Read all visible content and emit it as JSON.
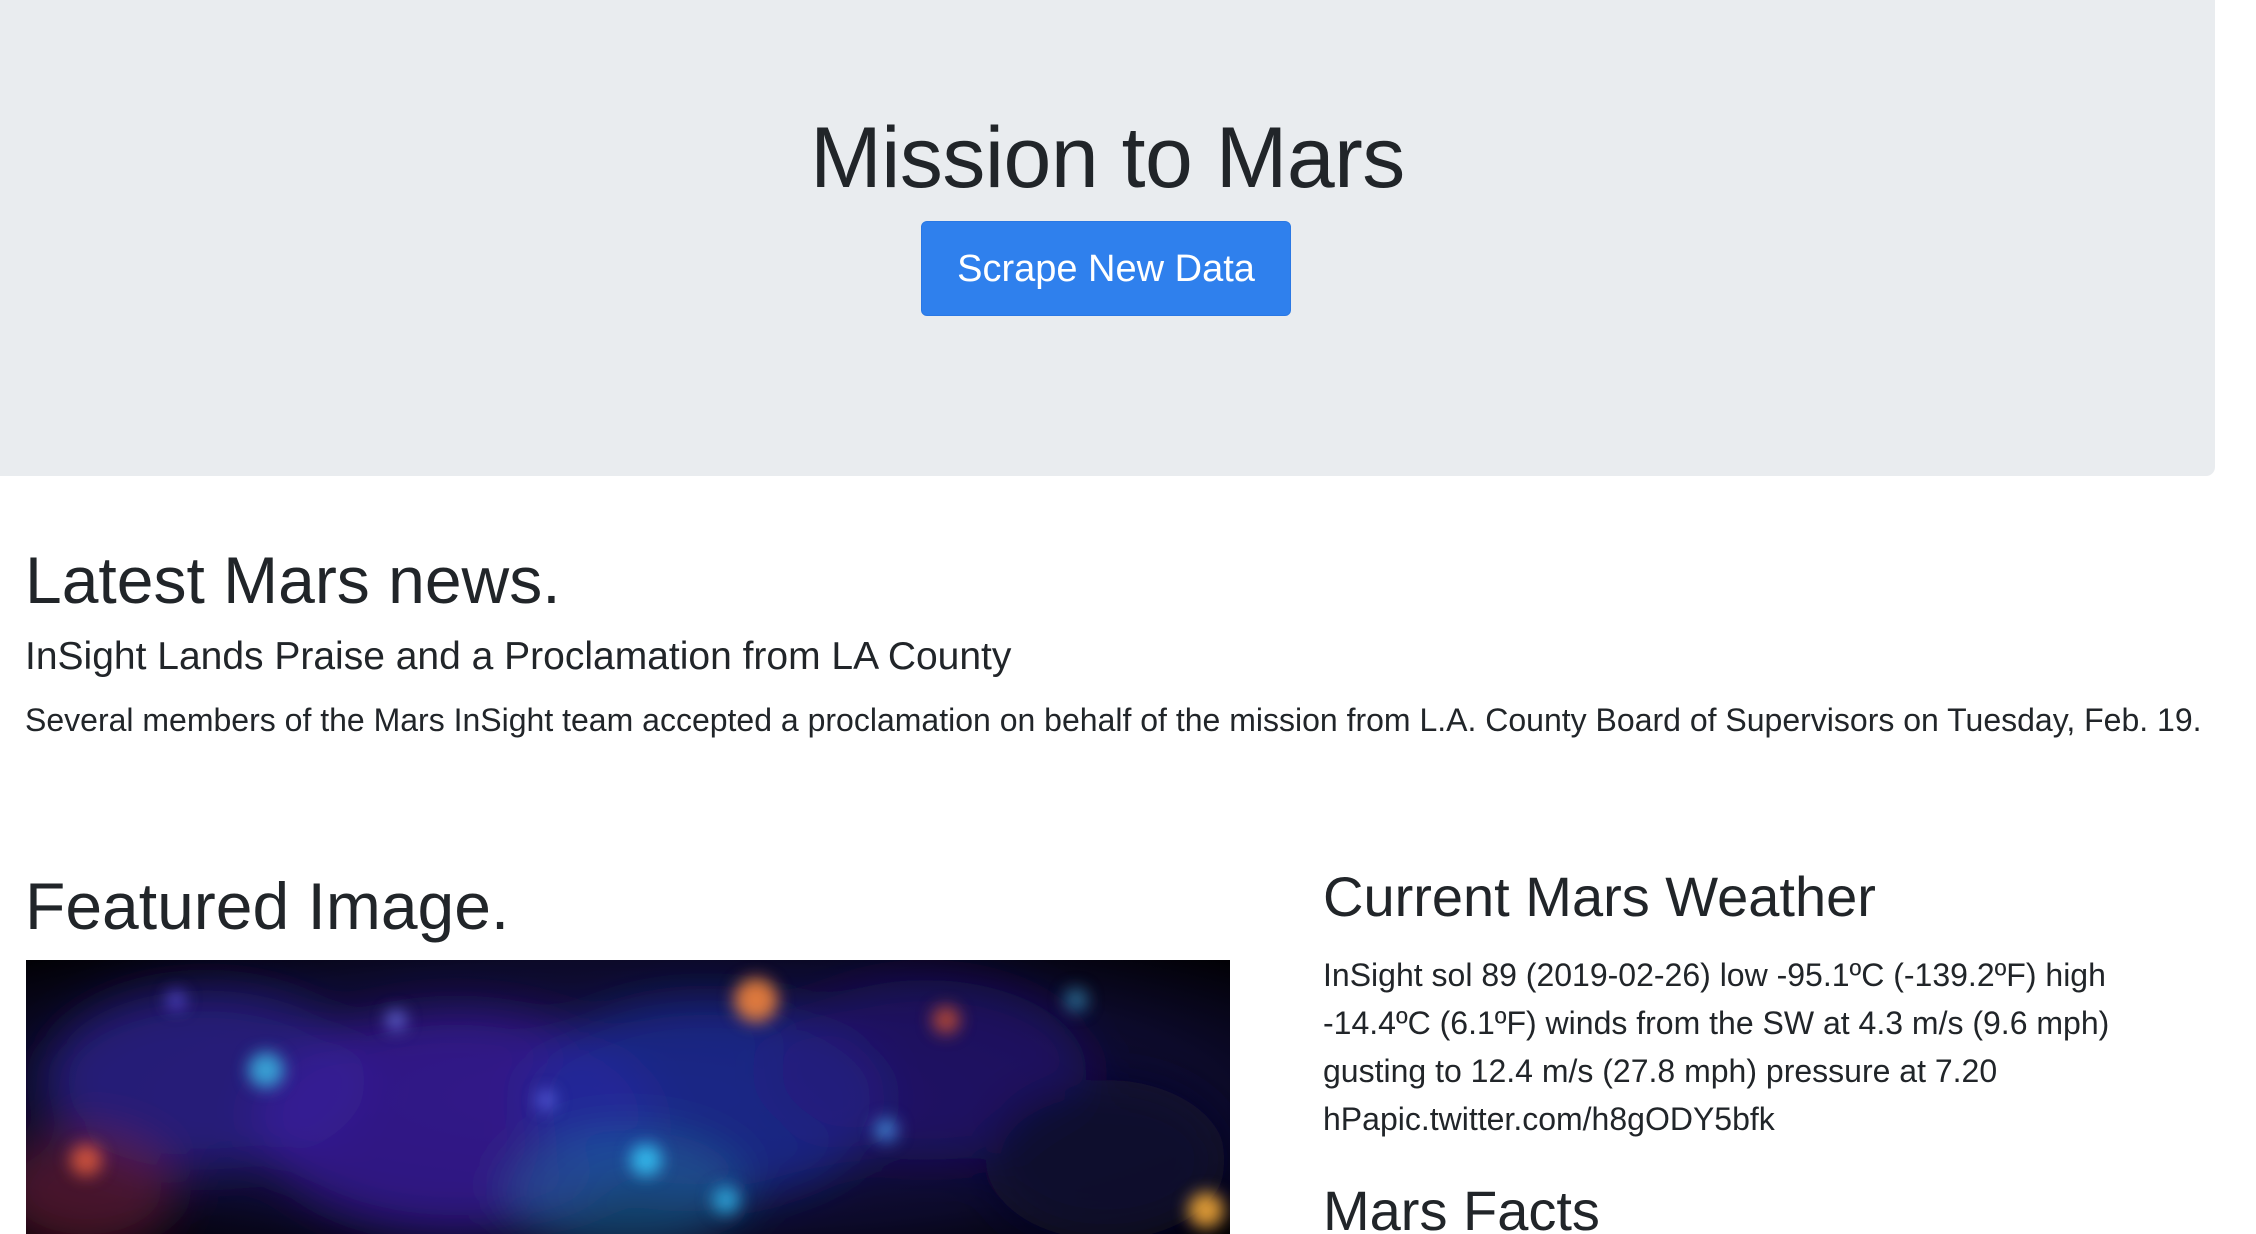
{
  "header": {
    "title": "Mission to Mars",
    "scrape_button_label": "Scrape New Data"
  },
  "news": {
    "heading": "Latest Mars news.",
    "title": "InSight Lands Praise and a Proclamation from LA County",
    "paragraph": "Several members of the Mars InSight team accepted a proclamation on behalf of the mission from L.A. County Board of Supervisors on Tuesday, Feb. 19."
  },
  "featured": {
    "heading": "Featured Image."
  },
  "weather": {
    "heading": "Current Mars Weather",
    "text": "InSight sol 89 (2019-02-26) low -95.1ºC (-139.2ºF) high -14.4ºC (6.1ºF) winds from the SW at 4.3 m/s (9.6 mph) gusting to 12.4 m/s (27.8 mph) pressure at 7.20 hPapic.twitter.com/h8gODY5bfk"
  },
  "facts": {
    "heading": "Mars Facts"
  },
  "colors": {
    "jumbotron_bg": "#e9ecef",
    "button_primary": "#2f80ed",
    "text": "#212529"
  }
}
